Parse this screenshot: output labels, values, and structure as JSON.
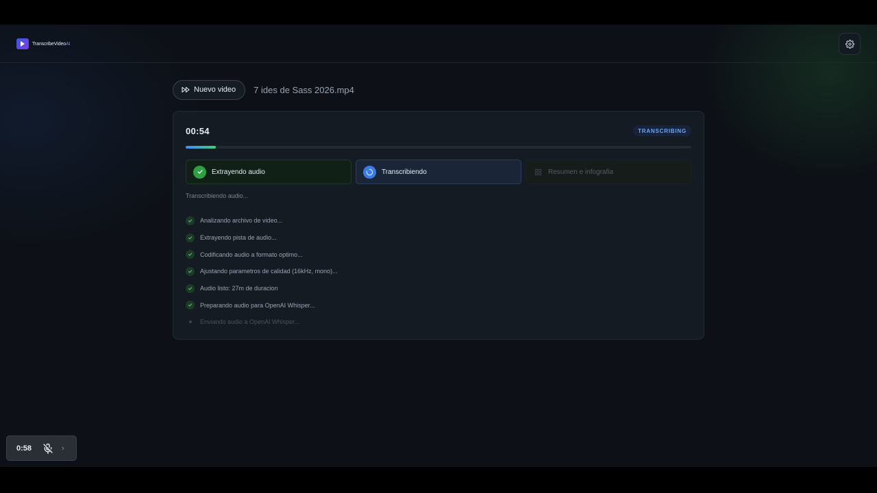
{
  "app": {
    "logo_text": "TranscribeVideo",
    "logo_suffix": "AI",
    "settings_icon": "gear-icon"
  },
  "header": {
    "new_video_label": "Nuevo video",
    "filename": "7 ides de Sass 2026.mp4"
  },
  "card": {
    "timer": "00:54",
    "status": "TRANSCRIBING",
    "progress_fraction": 0.06,
    "steps": [
      {
        "label": "Extrayendo audio",
        "state": "done"
      },
      {
        "label": "Transcribiendo",
        "state": "active"
      },
      {
        "label": "Resumen e infografia",
        "state": "pending"
      }
    ],
    "section_label": "Transcribiendo audio...",
    "log": [
      {
        "text": "Analizando archivo de video...",
        "done": true
      },
      {
        "text": "Extrayendo pista de audio...",
        "done": true
      },
      {
        "text": "Codificando audio a formato optimo...",
        "done": true
      },
      {
        "text": "Ajustando parametros de calidad (16kHz, mono)...",
        "done": true
      },
      {
        "text": "Audio listo: 27m de duracion",
        "done": true
      },
      {
        "text": "Preparando audio para OpenAI Whisper...",
        "done": true
      },
      {
        "text": "Enviando audio a OpenAI Whisper...",
        "done": false
      }
    ]
  },
  "recorder": {
    "time": "0:58",
    "mic_icon": "mic-off-icon",
    "chevron": "›"
  },
  "colors": {
    "accent_blue": "#3d7be0",
    "success_green": "#2ea043",
    "background": "#0d1117"
  }
}
